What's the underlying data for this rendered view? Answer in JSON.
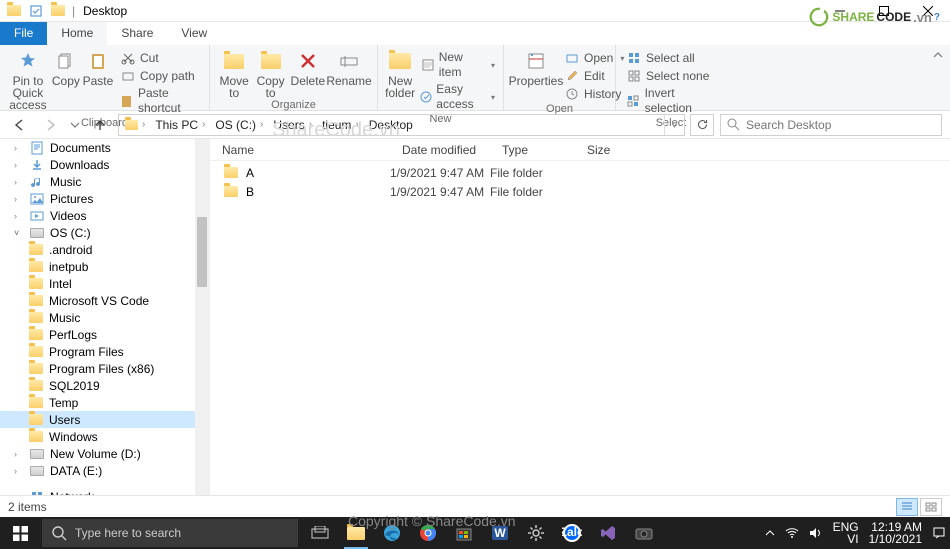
{
  "title": "Desktop",
  "watermark1": "ShareCode.vn",
  "watermark2": "Copyright © ShareCode.vn",
  "tabs": {
    "file": "File",
    "home": "Home",
    "share": "Share",
    "view": "View"
  },
  "ribbon": {
    "clipboard": {
      "label": "Clipboard",
      "pin": "Pin to Quick\naccess",
      "copy": "Copy",
      "paste": "Paste",
      "cut": "Cut",
      "copypath": "Copy path",
      "pasteshort": "Paste shortcut"
    },
    "organize": {
      "label": "Organize",
      "move": "Move\nto",
      "copy": "Copy\nto",
      "delete": "Delete",
      "rename": "Rename"
    },
    "new": {
      "label": "New",
      "folder": "New\nfolder",
      "newitem": "New item",
      "easy": "Easy access"
    },
    "open": {
      "label": "Open",
      "props": "Properties",
      "open": "Open",
      "edit": "Edit",
      "history": "History"
    },
    "select": {
      "label": "Select",
      "all": "Select all",
      "none": "Select none",
      "invert": "Invert selection"
    }
  },
  "breadcrumbs": [
    "This PC",
    "OS (C:)",
    "Users",
    "tieum",
    "Desktop"
  ],
  "search_placeholder": "Search Desktop",
  "tree": [
    {
      "icon": "doc",
      "label": "Documents",
      "lvl": 0
    },
    {
      "icon": "down",
      "label": "Downloads",
      "lvl": 0
    },
    {
      "icon": "music",
      "label": "Music",
      "lvl": 0
    },
    {
      "icon": "pic",
      "label": "Pictures",
      "lvl": 0
    },
    {
      "icon": "video",
      "label": "Videos",
      "lvl": 0
    },
    {
      "icon": "drive",
      "label": "OS (C:)",
      "lvl": 0,
      "exp": true
    },
    {
      "icon": "folder",
      "label": ".android",
      "lvl": 1
    },
    {
      "icon": "folder",
      "label": "inetpub",
      "lvl": 1
    },
    {
      "icon": "folder",
      "label": "Intel",
      "lvl": 1
    },
    {
      "icon": "folder",
      "label": "Microsoft VS Code",
      "lvl": 1
    },
    {
      "icon": "folder",
      "label": "Music",
      "lvl": 1
    },
    {
      "icon": "folder",
      "label": "PerfLogs",
      "lvl": 1
    },
    {
      "icon": "folder",
      "label": "Program Files",
      "lvl": 1
    },
    {
      "icon": "folder",
      "label": "Program Files (x86)",
      "lvl": 1
    },
    {
      "icon": "folder",
      "label": "SQL2019",
      "lvl": 1
    },
    {
      "icon": "folder",
      "label": "Temp",
      "lvl": 1
    },
    {
      "icon": "folder",
      "label": "Users",
      "lvl": 1,
      "sel": true
    },
    {
      "icon": "folder",
      "label": "Windows",
      "lvl": 1
    },
    {
      "icon": "drive",
      "label": "New Volume (D:)",
      "lvl": 0
    },
    {
      "icon": "drive",
      "label": "DATA (E:)",
      "lvl": 0
    },
    {
      "spacer": true
    },
    {
      "icon": "net",
      "label": "Network",
      "lvl": 0
    }
  ],
  "columns": {
    "name": "Name",
    "date": "Date modified",
    "type": "Type",
    "size": "Size"
  },
  "rows": [
    {
      "name": "A",
      "date": "1/9/2021 9:47 AM",
      "type": "File folder"
    },
    {
      "name": "B",
      "date": "1/9/2021 9:47 AM",
      "type": "File folder"
    }
  ],
  "status": "2 items",
  "taskbar": {
    "search_placeholder": "Type here to search",
    "lang1": "ENG",
    "lang2": "VI",
    "time": "12:19 AM",
    "date": "1/10/2021"
  }
}
